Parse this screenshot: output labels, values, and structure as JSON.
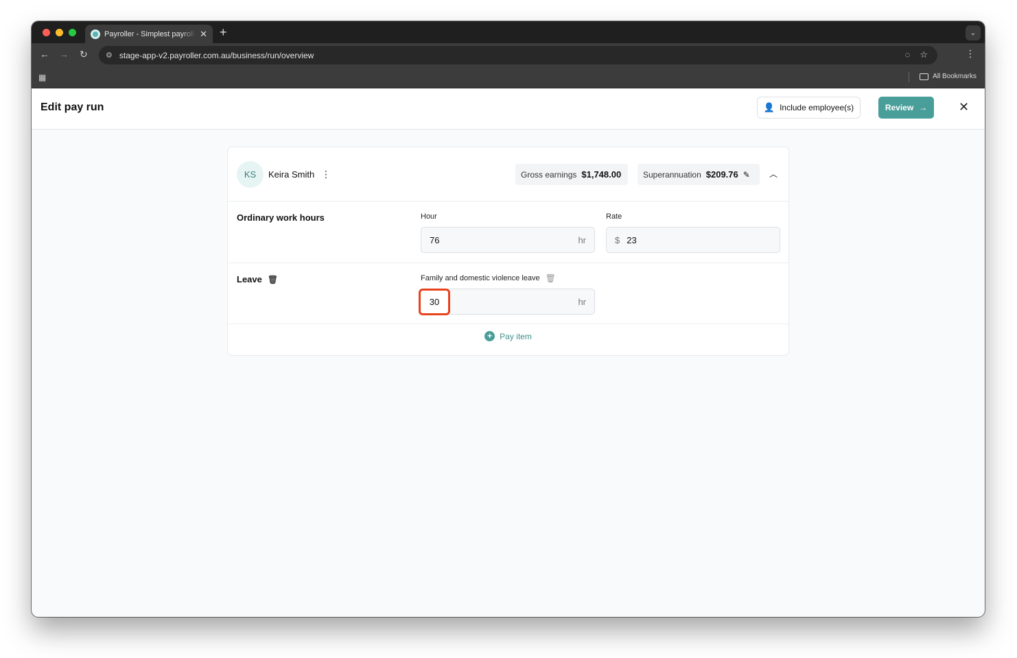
{
  "browser": {
    "tab_title": "Payroller - Simplest payroll sc",
    "url": "stage-app-v2.payroller.com.au/business/run/overview",
    "bookmarks_label": "All Bookmarks"
  },
  "header": {
    "title": "Edit pay run",
    "include_label": "Include employee(s)",
    "review_label": "Review"
  },
  "employee": {
    "initials": "KS",
    "name": "Keira Smith",
    "gross_label": "Gross earnings",
    "gross_value": "$1,748.00",
    "super_label": "Superannuation",
    "super_value": "$209.76"
  },
  "ordinary": {
    "label": "Ordinary work hours",
    "hour_label": "Hour",
    "hour_value": "76",
    "hour_suffix": "hr",
    "rate_label": "Rate",
    "rate_prefix": "$",
    "rate_value": "23"
  },
  "leave": {
    "label": "Leave",
    "type_label": "Family and domestic violence leave",
    "value": "30",
    "suffix": "hr"
  },
  "pay_item_label": "Pay item",
  "colors": {
    "accent": "#4a9e9a",
    "highlight": "#e8421c"
  }
}
